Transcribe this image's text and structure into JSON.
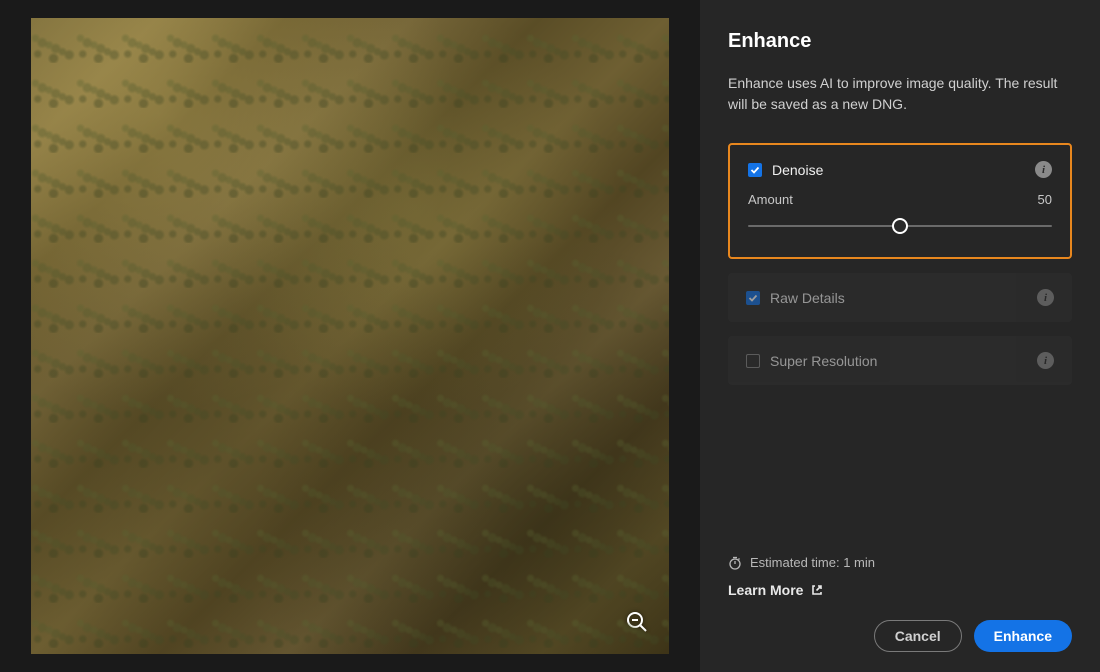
{
  "title": "Enhance",
  "description": "Enhance uses AI to improve image quality. The result will be saved as a new DNG.",
  "options": {
    "denoise": {
      "label": "Denoise",
      "amount_label": "Amount",
      "amount_value": "50"
    },
    "raw_details": {
      "label": "Raw Details"
    },
    "super_resolution": {
      "label": "Super Resolution"
    }
  },
  "footer": {
    "estimated": "Estimated time: 1 min",
    "learn_more": "Learn More"
  },
  "buttons": {
    "cancel": "Cancel",
    "enhance": "Enhance"
  }
}
